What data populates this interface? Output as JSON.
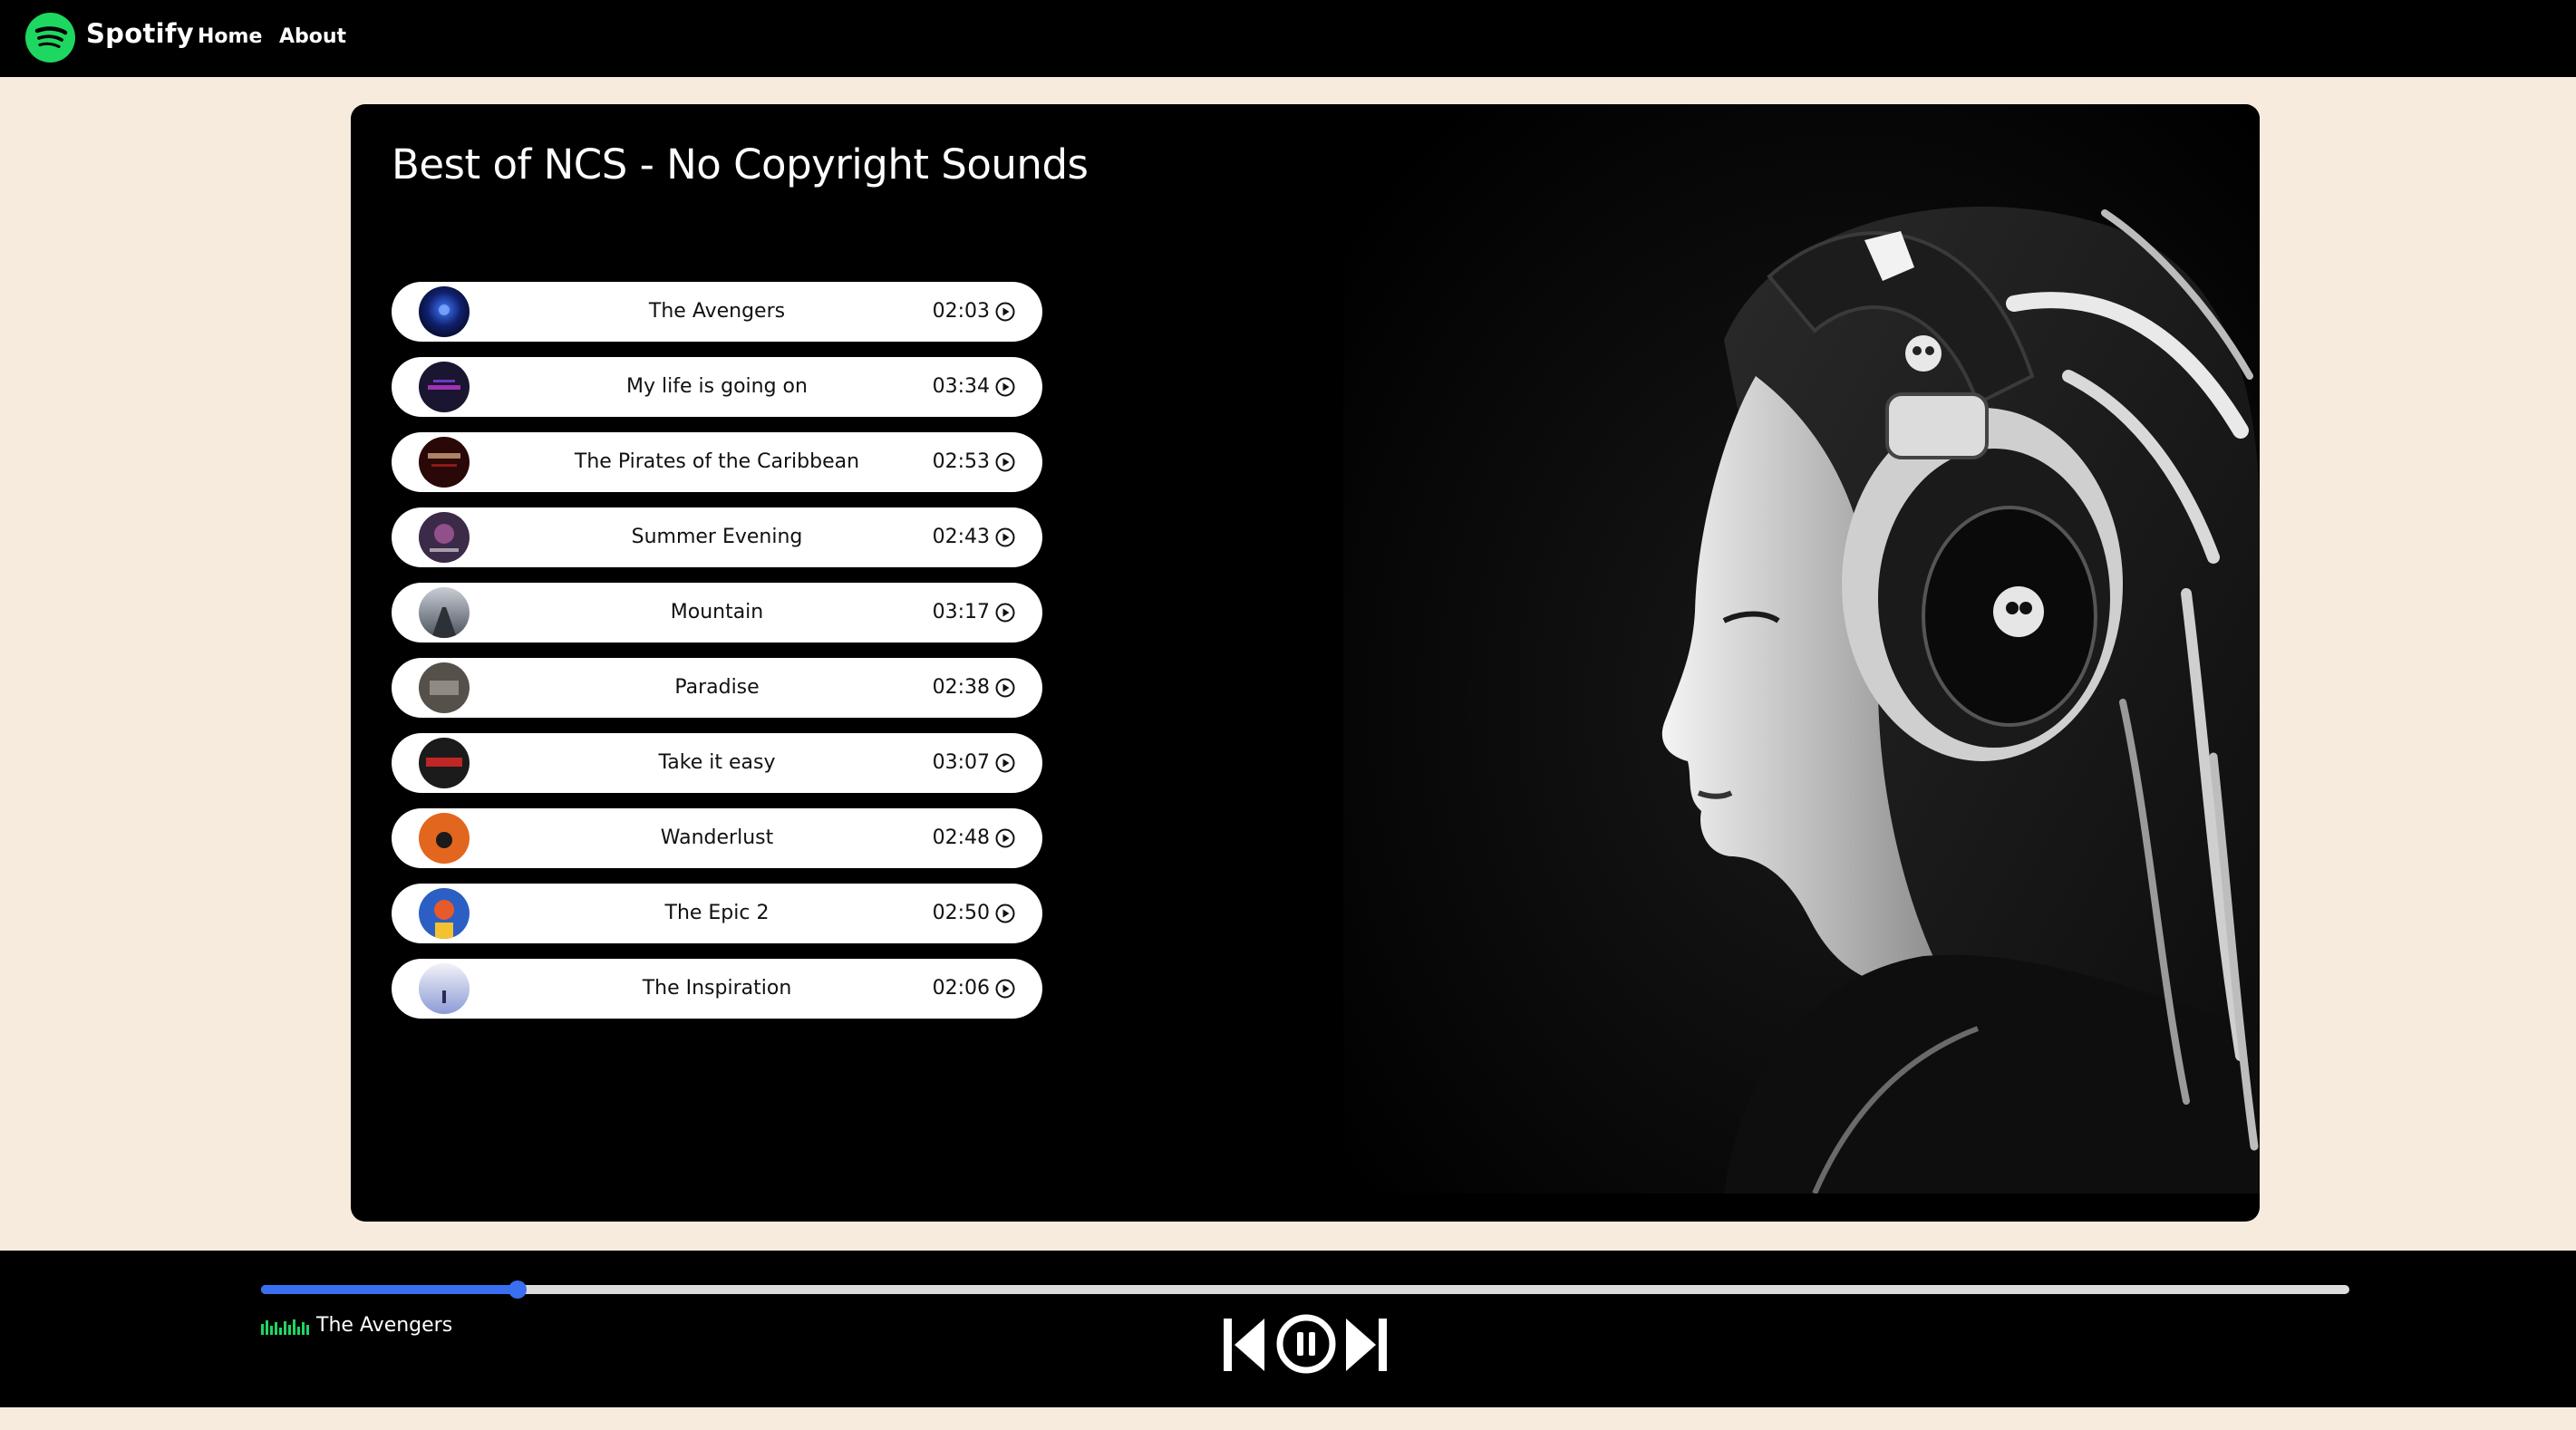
{
  "nav": {
    "brand": "Spotify",
    "links": [
      "Home",
      "About"
    ]
  },
  "playlist": {
    "title": "Best of NCS - No Copyright Sounds",
    "songs": [
      {
        "name": "The Avengers",
        "duration": "02:03"
      },
      {
        "name": "My life is going on",
        "duration": "03:34"
      },
      {
        "name": "The Pirates of the Caribbean",
        "duration": "02:53"
      },
      {
        "name": "Summer Evening",
        "duration": "02:43"
      },
      {
        "name": "Mountain",
        "duration": "03:17"
      },
      {
        "name": "Paradise",
        "duration": "02:38"
      },
      {
        "name": "Take it easy",
        "duration": "03:07"
      },
      {
        "name": "Wanderlust",
        "duration": "02:48"
      },
      {
        "name": "The Epic 2",
        "duration": "02:50"
      },
      {
        "name": "The Inspiration",
        "duration": "02:06"
      }
    ]
  },
  "player": {
    "now_playing": "The Avengers",
    "progress_fraction": 0.123
  },
  "colors": {
    "accent": "#3a6ff2",
    "brand_green": "#1ed760",
    "page_bg": "#f6ebdc",
    "panel_bg": "#000000"
  },
  "icons": {
    "logo": "spotify-logo-icon",
    "play": "play-circle-icon",
    "prev": "skip-previous-icon",
    "pause": "pause-circle-icon",
    "next": "skip-next-icon",
    "eq": "equalizer-icon"
  }
}
